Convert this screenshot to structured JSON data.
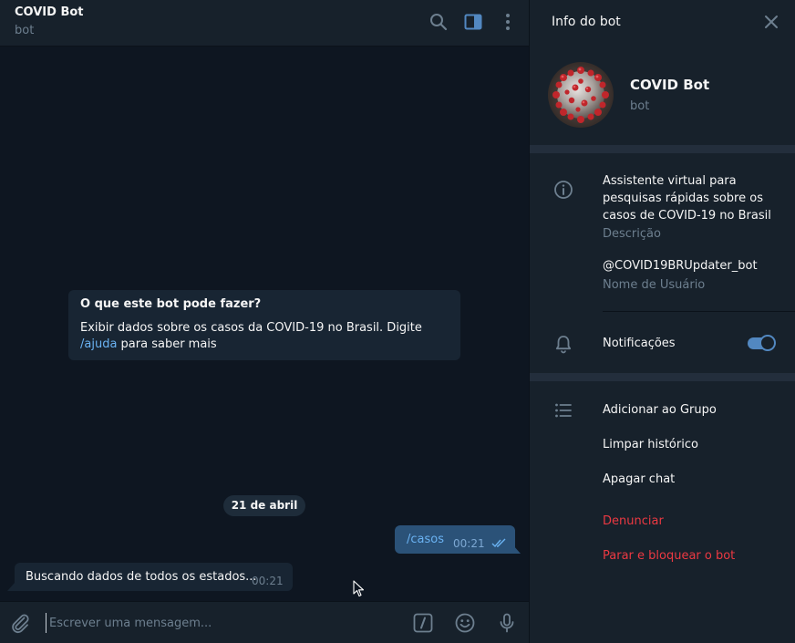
{
  "chat": {
    "title": "COVID Bot",
    "status": "bot",
    "intro": {
      "title": "O que este bot pode fazer?",
      "text_before": "Exibir dados sobre os casos da COVID-19 no Brasil. Digite ",
      "link": "/ajuda",
      "text_after": " para saber mais"
    },
    "date_separator": "21 de abril",
    "messages": [
      {
        "direction": "out",
        "text": "/casos",
        "time": "00:21",
        "read": true
      },
      {
        "direction": "in",
        "text": "Buscando dados de todos os estados...",
        "time": "00:21"
      }
    ],
    "composer": {
      "placeholder": "Escrever uma mensagem...",
      "value": ""
    }
  },
  "panel": {
    "title": "Info do bot",
    "bot_name": "COVID Bot",
    "bot_status": "bot",
    "description": "Assistente virtual para pesquisas rápidas sobre os casos de COVID-19 no Brasil",
    "description_label": "Descrição",
    "username": "@COVID19BRUpdater_bot",
    "username_label": "Nome de Usuário",
    "notifications_label": "Notificações",
    "notifications_enabled": true,
    "actions": {
      "add_to_group": "Adicionar ao Grupo",
      "clear_history": "Limpar histórico",
      "delete_chat": "Apagar chat",
      "report": "Denunciar",
      "stop_block": "Parar e bloquear o bot"
    }
  },
  "colors": {
    "accent": "#5288c1",
    "link": "#6ab2f2",
    "danger": "#ec3942",
    "chat_background": "#0e1621",
    "panel_background": "#17212b",
    "outgoing_bubble": "#2b5278",
    "incoming_bubble": "#182533"
  },
  "icons": {
    "header": [
      "search-icon",
      "sidebar-toggle-icon",
      "more-vertical-icon"
    ],
    "composer": [
      "attach-icon",
      "bot-commands-icon",
      "emoji-icon",
      "microphone-icon"
    ],
    "panel": [
      "close-icon",
      "info-icon",
      "bell-icon",
      "list-icon"
    ]
  }
}
